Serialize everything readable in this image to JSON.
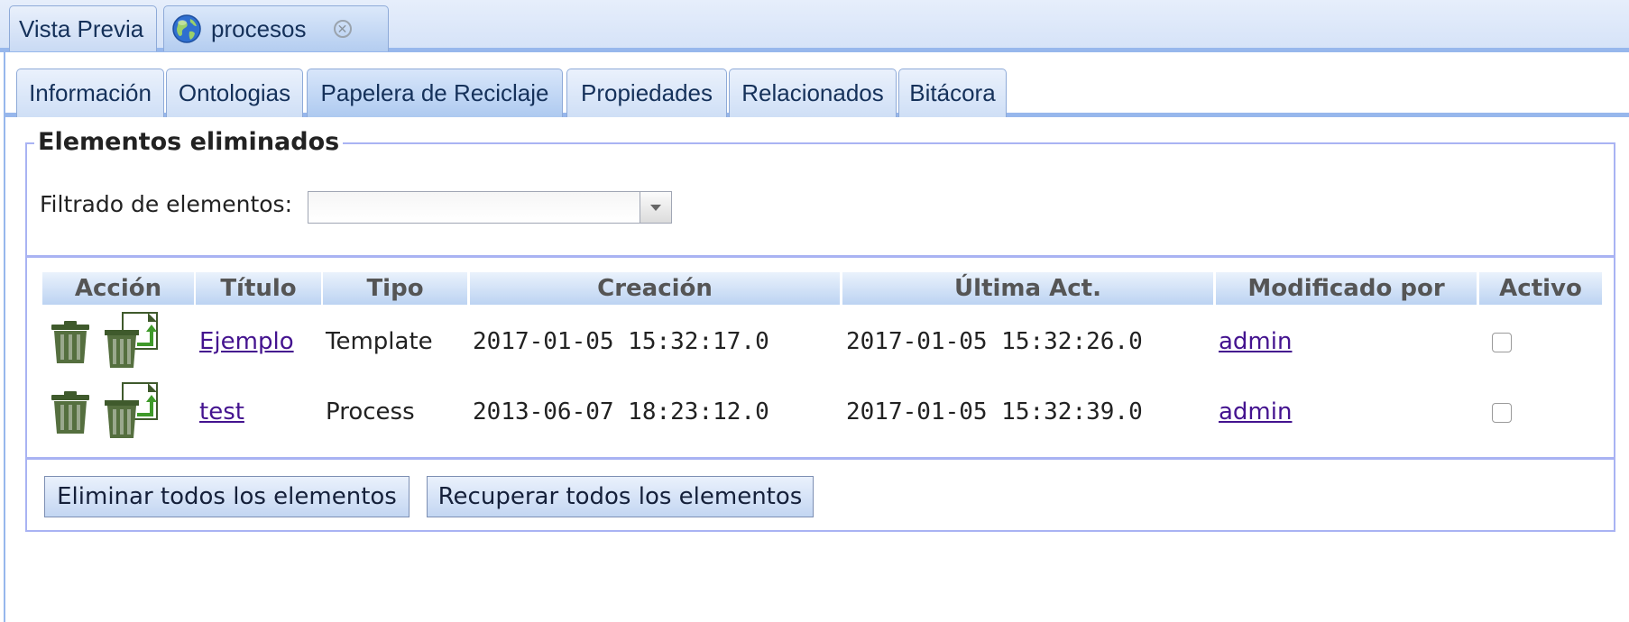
{
  "top_tabs": [
    {
      "label": "Vista Previa",
      "active": false
    },
    {
      "label": "procesos",
      "active": true,
      "icon": "globe-icon",
      "closable": true
    }
  ],
  "sub_tabs": [
    {
      "label": "Información"
    },
    {
      "label": "Ontologias"
    },
    {
      "label": "Papelera de Reciclaje",
      "active": true
    },
    {
      "label": "Propiedades"
    },
    {
      "label": "Relacionados"
    },
    {
      "label": "Bitácora"
    }
  ],
  "panel": {
    "legend": "Elementos eliminados",
    "filter_label": "Filtrado de elementos:",
    "filter_value": ""
  },
  "table": {
    "headers": [
      "Acción",
      "Título",
      "Tipo",
      "Creación",
      "Última Act.",
      "Modificado por",
      "Activo"
    ],
    "rows": [
      {
        "title": "Ejemplo",
        "type": "Template",
        "created": "2017-01-05 15:32:17.0",
        "updated": "2017-01-05 15:32:26.0",
        "modified_by": "admin",
        "active": false
      },
      {
        "title": "test",
        "type": "Process",
        "created": "2013-06-07 18:23:12.0",
        "updated": "2017-01-05 15:32:39.0",
        "modified_by": "admin",
        "active": false
      }
    ]
  },
  "buttons": {
    "delete_all": "Eliminar todos los elementos",
    "recover_all": "Recuperar todos los elementos"
  },
  "colors": {
    "tab_border": "#97b7ec",
    "fieldset_border": "#a9b3f3",
    "link": "#44138f",
    "trash_green": "#4e6a3a",
    "restore_arrow": "#3f9a2a"
  }
}
